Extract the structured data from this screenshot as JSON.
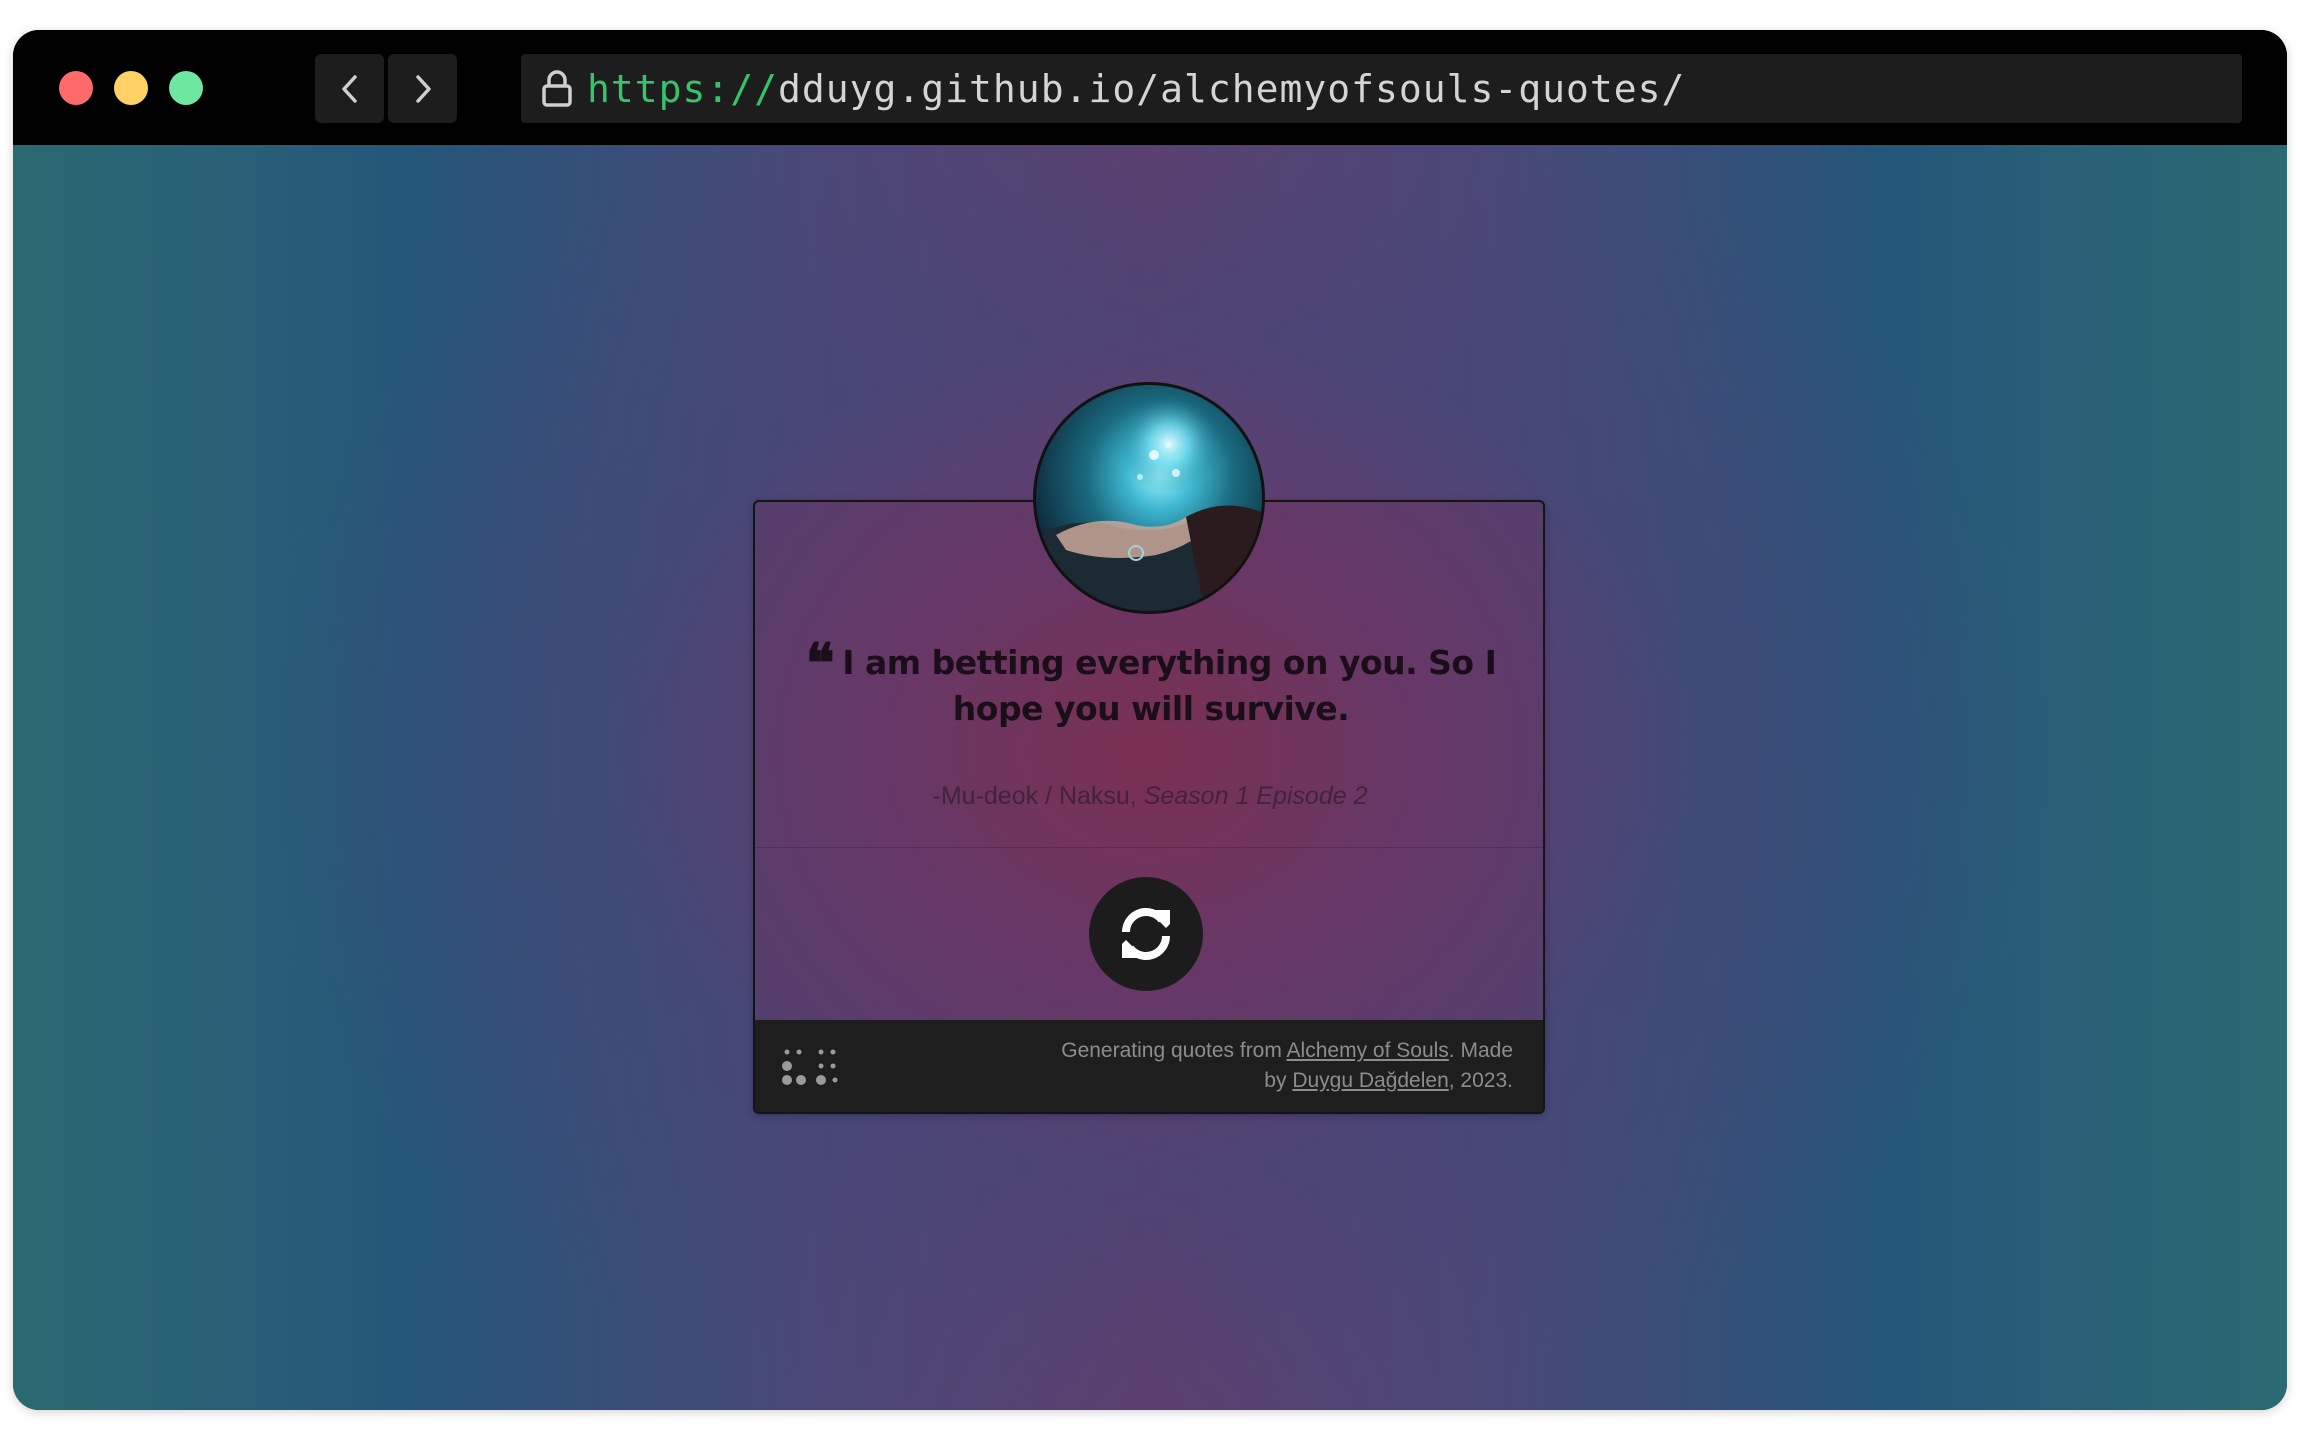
{
  "browser": {
    "url_scheme": "https://",
    "url_rest": "dduyg.github.io/alchemyofsouls-quotes/"
  },
  "card": {
    "quote_mark": "❝",
    "quote_text": "I am betting everything on you. So I hope you will survive.",
    "attribution_speaker": "-Mu-deok / Naksu, ",
    "attribution_episode": "Season 1 Episode 2",
    "footer": {
      "prefix": "Generating quotes from ",
      "show_link": "Alchemy of Souls",
      "middle": ". Made by ",
      "author_link": "Duygu Dağdelen",
      "suffix": ", 2023."
    }
  },
  "colors": {
    "scheme_green": "#35c46a",
    "traffic_red": "#ff6b6b",
    "traffic_yellow": "#ffd166",
    "traffic_green": "#6ee7a0"
  },
  "icons": {
    "lock": "lock-icon",
    "back": "chevron-left-icon",
    "forward": "chevron-right-icon",
    "refresh": "refresh-icon",
    "logo": "dots-logo-icon"
  }
}
